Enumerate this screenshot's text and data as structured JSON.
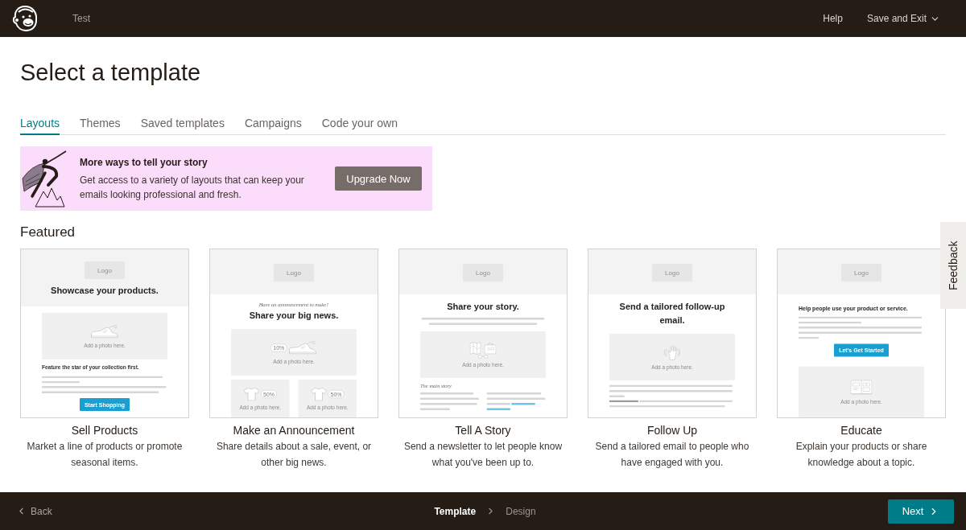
{
  "topbar": {
    "app_name": "Test",
    "links": [
      {
        "label": "Help",
        "kind": "link"
      },
      {
        "label": "Save and Exit",
        "kind": "menu"
      }
    ]
  },
  "page_title": "Select a template",
  "tabs": [
    {
      "label": "Layouts",
      "selected": true
    },
    {
      "label": "Themes",
      "selected": false
    },
    {
      "label": "Saved templates",
      "selected": false
    },
    {
      "label": "Campaigns",
      "selected": false
    },
    {
      "label": "Code your own",
      "selected": false
    }
  ],
  "promo": {
    "title": "More ways to tell your story",
    "body": "Get access to a variety of layouts that can keep your emails looking professional and fresh.",
    "button": "Upgrade Now"
  },
  "section_title": "Featured",
  "templates": [
    {
      "name": "Sell Products",
      "description": "Market a line of products or promote seasonal items.",
      "preview": {
        "logo": "Logo",
        "header_heading": "Showcase your products.",
        "blocks": [
          {
            "kind": "photo",
            "caption": "Add a photo here."
          },
          {
            "kind": "subheading",
            "text": "Feature the star of your collection first."
          },
          {
            "kind": "text_lines"
          },
          {
            "kind": "text_lines"
          },
          {
            "kind": "button",
            "text": "Start Shopping"
          }
        ]
      }
    },
    {
      "name": "Make an Announcement",
      "description": "Share details about a sale, event, or other big news.",
      "preview": {
        "logo": "Logo",
        "blocks": [
          {
            "kind": "kicker",
            "text": "Have an announcement to make?"
          },
          {
            "kind": "heading",
            "text": "Share your big news."
          },
          {
            "kind": "photo",
            "caption": "Add a photo here.",
            "tag": "10%"
          },
          {
            "kind": "photo_pair",
            "items": [
              {
                "caption": "Add a photo here.",
                "tag": "50%"
              },
              {
                "caption": "Add a photo here.",
                "tag": "50%"
              }
            ]
          }
        ]
      }
    },
    {
      "name": "Tell A Story",
      "description": "Send a newsletter to let people know what you've been up to.",
      "preview": {
        "logo": "Logo",
        "blocks": [
          {
            "kind": "heading",
            "text": "Share your story."
          },
          {
            "kind": "intro_lines"
          },
          {
            "kind": "photo",
            "caption": "Add a photo here."
          },
          {
            "kind": "section",
            "text": "The main story"
          },
          {
            "kind": "column_lines"
          }
        ]
      }
    },
    {
      "name": "Follow Up",
      "description": "Send a tailored email to people who have engaged with you.",
      "preview": {
        "logo": "Logo",
        "blocks": [
          {
            "kind": "heading",
            "text": "Send a tailored follow-up email."
          },
          {
            "kind": "photo",
            "caption": "Add a photo here."
          },
          {
            "kind": "text_lines"
          },
          {
            "kind": "text_lines"
          }
        ]
      }
    },
    {
      "name": "Educate",
      "description": "Explain your products or share knowledge about a topic.",
      "preview": {
        "logo": "Logo",
        "blocks": [
          {
            "kind": "title",
            "text": "Help people use your product or service."
          },
          {
            "kind": "text_lines"
          },
          {
            "kind": "text_lines"
          },
          {
            "kind": "button",
            "text": "Let's Get Started"
          },
          {
            "kind": "photo",
            "caption": "Add a photo here."
          }
        ]
      }
    }
  ],
  "feedback_tab": {
    "label": "Feedback"
  },
  "footer": {
    "back": "Back",
    "steps": [
      {
        "label": "Template",
        "selected": true
      },
      {
        "label": "Design",
        "selected": false
      }
    ],
    "next": "Next"
  }
}
